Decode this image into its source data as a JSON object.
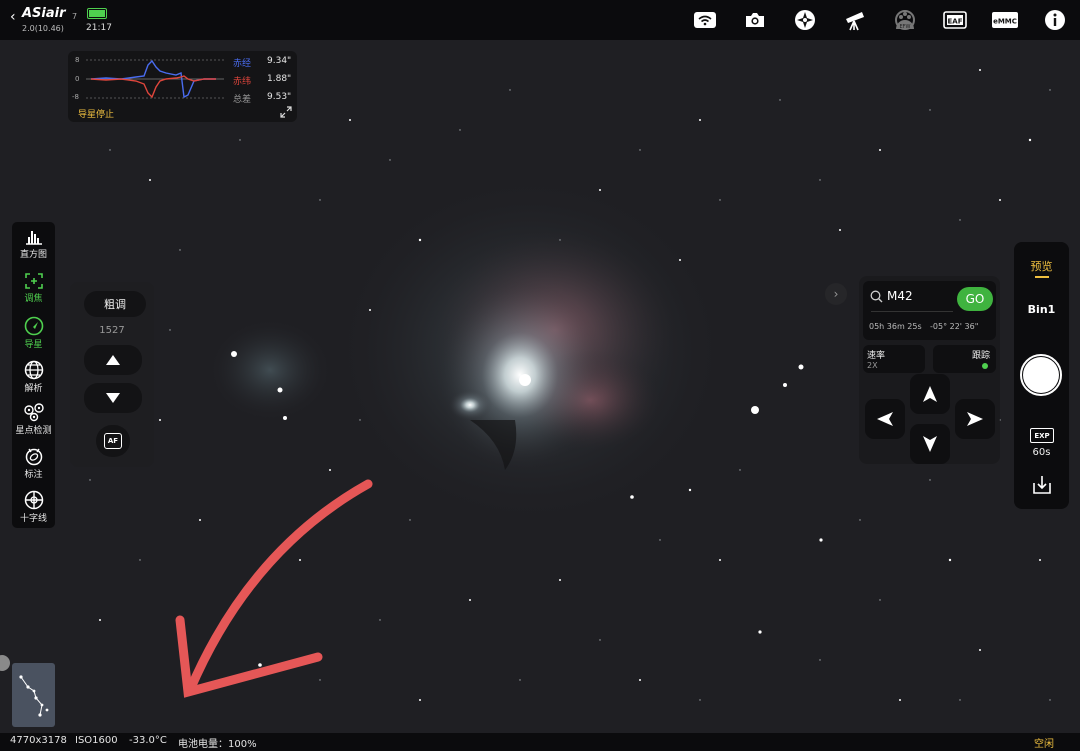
{
  "app": {
    "logo": "ASiair",
    "version": "2.0(10.46)",
    "time": "21:17",
    "notice_digit": "7"
  },
  "top_icons": [
    "wifi-icon",
    "camera-icon",
    "mount-icon",
    "telescope-icon",
    "efw-icon",
    "eaf-icon",
    "emmc-icon",
    "info-icon"
  ],
  "top_icon_labels": {
    "efw": "EFW",
    "eaf": "EAF",
    "emmc": "eMMC"
  },
  "guide": {
    "axis_top": "8",
    "axis_mid": "0",
    "axis_bot": "-8",
    "ra_label": "赤经",
    "ra_value": "9.34\"",
    "dec_label": "赤纬",
    "dec_value": "1.88\"",
    "total_label": "总差",
    "total_value": "9.53\"",
    "status": "导星停止",
    "colors": {
      "ra": "#4a6cf0",
      "dec": "#e0463c",
      "status": "#f0c040"
    }
  },
  "left_toolbar": {
    "histogram": "直方图",
    "focus": "调焦",
    "guide": "导星",
    "solve": "解析",
    "star_detect": "星点检测",
    "annotate": "标注",
    "crosshair": "十字线",
    "active_color": "#4fd04f"
  },
  "focus_panel": {
    "mode": "粗调",
    "position": "1527",
    "af": "AF"
  },
  "goto": {
    "target": "M42",
    "go": "GO",
    "ra": "05h 36m 25s",
    "dec": "-05° 22' 36\"",
    "rate_label": "速率",
    "rate_value": "2X",
    "tracking_label": "跟踪",
    "go_color": "#3fb33f"
  },
  "right_panel": {
    "preview": "预览",
    "bin": "Bin1",
    "exp_badge": "EXP",
    "exposure": "60s",
    "accent": "#f0c040"
  },
  "status_bar": {
    "resolution": "4770x3178",
    "iso": "ISO1600",
    "temp": "-33.0°C",
    "battery_label": "电池电量：100%",
    "state": "空闲"
  }
}
